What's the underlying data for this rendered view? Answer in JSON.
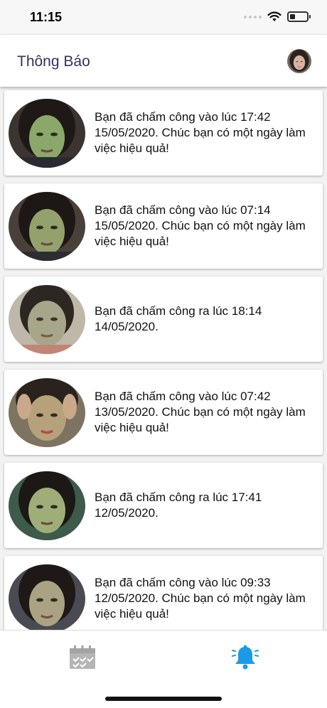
{
  "status": {
    "time": "11:15"
  },
  "header": {
    "title": "Thông Báo"
  },
  "notifications": [
    {
      "message": "Bạn đã chấm công vào lúc 17:42 15/05/2020. Chúc bạn có một ngày làm việc hiệu quả!"
    },
    {
      "message": "Bạn đã chấm công vào lúc 07:14 15/05/2020. Chúc bạn có một ngày làm việc hiệu quả!"
    },
    {
      "message": "Bạn đã chấm công ra lúc 18:14 14/05/2020."
    },
    {
      "message": "Bạn đã chấm công vào lúc 07:42 13/05/2020. Chúc bạn có một ngày làm việc hiệu quả!"
    },
    {
      "message": "Bạn đã chấm công ra lúc 17:41 12/05/2020."
    },
    {
      "message": "Bạn đã chấm công vào lúc 09:33 12/05/2020. Chúc bạn có một ngày làm việc hiệu quả!"
    }
  ],
  "tabs": [
    {
      "icon": "calendar-icon",
      "active": false
    },
    {
      "icon": "bell-icon",
      "active": true
    }
  ],
  "colors": {
    "active_tab": "#1a9be8",
    "inactive_tab": "#b5b5b5",
    "header_title": "#33335a"
  }
}
